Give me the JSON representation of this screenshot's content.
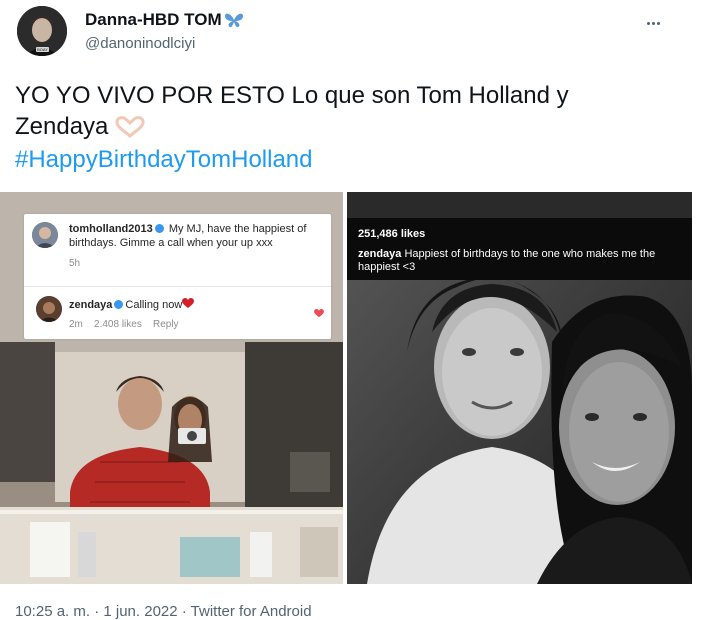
{
  "author": {
    "name": "Danna-HBD TOM",
    "handle": "@danoninodlciyi",
    "avatar_text": "BOAY"
  },
  "tweet": {
    "text": "YO YO VIVO POR ESTO Lo que son Tom Holland y Zendaya",
    "hashtag": "#HappyBirthdayTomHolland"
  },
  "left_photo": {
    "comment1_user": "tomholland2013",
    "comment1_text": "My MJ, have the happiest of birthdays. Gimme a call when your up xxx",
    "comment1_time": "5h",
    "comment2_user": "zendaya",
    "comment2_text": "Calling now",
    "comment2_time": "2m",
    "comment2_likes": "2.408 likes",
    "comment2_reply": "Reply"
  },
  "right_photo": {
    "likes": "251,486 likes",
    "caption_user": "zendaya",
    "caption_text": "Happiest of birthdays to the one who makes me the happiest <3"
  },
  "footer": {
    "meta": "10:25 a. m. · 1 jun. 2022 · Twitter for Android"
  },
  "colors": {
    "link": "#1d9bf0",
    "secondary": "#536471",
    "heart": "#ed4956"
  }
}
